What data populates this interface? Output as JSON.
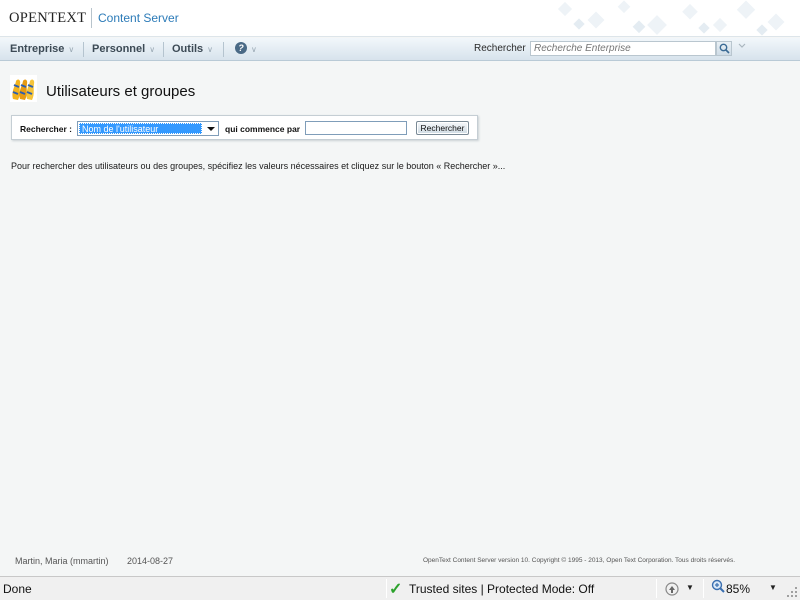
{
  "header": {
    "logo_open": "Open",
    "logo_text": "Text",
    "product": "Content Server"
  },
  "nav": {
    "items": [
      {
        "label": "Entreprise"
      },
      {
        "label": "Personnel"
      },
      {
        "label": "Outils"
      }
    ],
    "help_glyph": "?",
    "chevron": "∨",
    "search_label": "Rechercher",
    "search_placeholder": "Recherche Enterprise"
  },
  "page": {
    "title": "Utilisateurs et groupes",
    "icon": "users-groups-icon"
  },
  "search_form": {
    "label": "Rechercher :",
    "field_selected": "Nom de l'utilisateur",
    "operator_label": "qui commence par",
    "value": "",
    "button_label": "Rechercher"
  },
  "instructions": "Pour rechercher des utilisateurs ou des groupes, spécifiez les valeurs nécessaires et cliquez sur le bouton « Rechercher »...",
  "footer": {
    "user": "Martin, Maria (mmartin)",
    "date": "2014-08-27",
    "copyright": "OpenText Content Server version 10. Copyright © 1995 - 2013, Open Text Corporation. Tous droits réservés."
  },
  "statusbar": {
    "status": "Done",
    "zone": "Trusted sites | Protected Mode: Off",
    "zoom": "85%"
  },
  "colors": {
    "accent": "#2c7bb8",
    "selection": "#3399ff",
    "check": "#2ca22c"
  }
}
